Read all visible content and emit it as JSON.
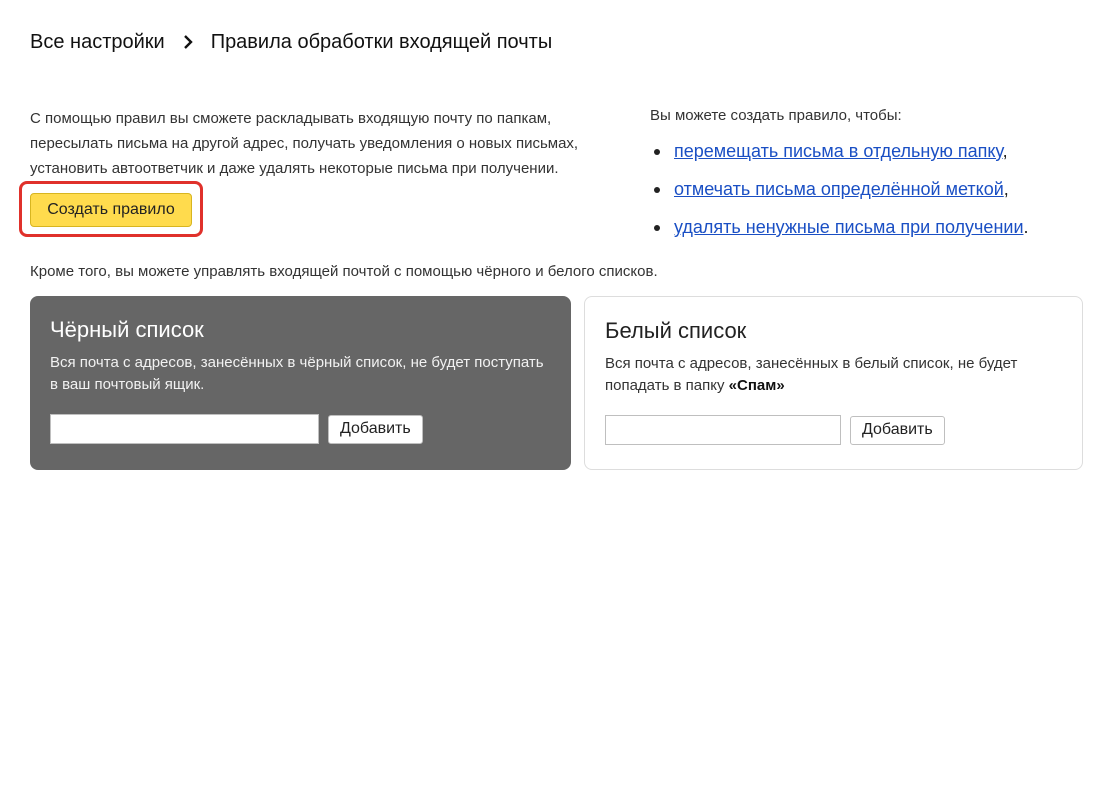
{
  "breadcrumb": {
    "root": "Все настройки",
    "current": "Правила обработки входящей почты"
  },
  "intro": {
    "text": "С помощью правил вы сможете раскладывать входящую почту по папкам, пересылать письма на другой адрес, получать уведомления о новых письмах, установить автоответчик и даже удалять некоторые письма при получении.",
    "create_button": "Создать правило"
  },
  "rules": {
    "heading": "Вы можете создать правило, чтобы:",
    "items": [
      {
        "link": "перемещать письма в отдельную папку",
        "suffix": ","
      },
      {
        "link": "отмечать письма определённой меткой",
        "suffix": ","
      },
      {
        "link": "удалять ненужные письма при получении",
        "suffix": "."
      }
    ]
  },
  "lists_note": "Кроме того, вы можете управлять входящей почтой с помощью чёрного и белого списков.",
  "blacklist": {
    "title": "Чёрный список",
    "description": "Вся почта с адресов, занесённых в чёрный список, не будет поступать в ваш почтовый ящик.",
    "input_value": "",
    "add_button": "Добавить"
  },
  "whitelist": {
    "title": "Белый список",
    "description_prefix": "Вся почта с адресов, занесённых в белый список, не будет попадать в папку ",
    "spam_folder": "«Спам»",
    "input_value": "",
    "add_button": "Добавить"
  },
  "colors": {
    "accent_yellow": "#ffdb4d",
    "highlight_red": "#e0312b",
    "link_blue": "#1a4fc4",
    "blacklist_bg": "#666666"
  }
}
